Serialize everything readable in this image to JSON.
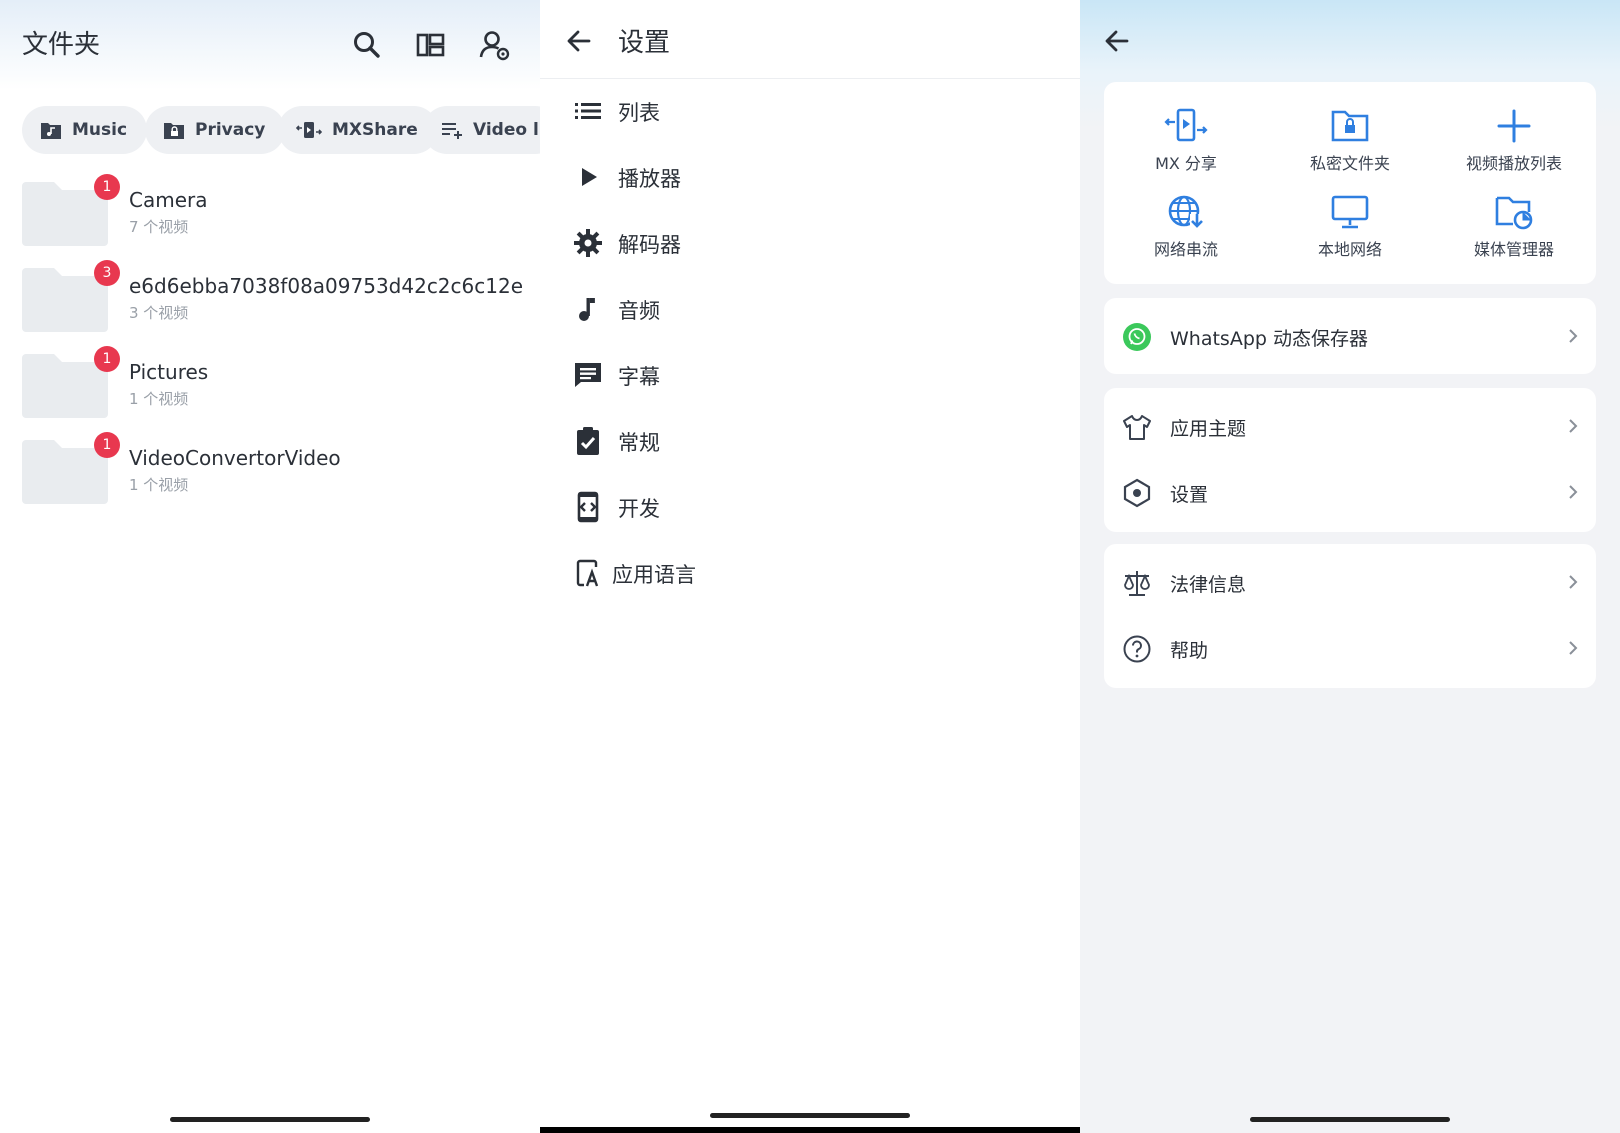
{
  "panel1": {
    "title": "文件夹",
    "icons": [
      "search-icon",
      "layout-icon",
      "account-settings-icon"
    ],
    "chips": [
      {
        "label": "Music",
        "icon": "music-folder-icon"
      },
      {
        "label": "Privacy",
        "icon": "lock-folder-icon"
      },
      {
        "label": "MXShare",
        "icon": "share-icon"
      },
      {
        "label": "Video l",
        "icon": "playlist-add-icon"
      }
    ],
    "folders": [
      {
        "name": "Camera",
        "count": "7 个视频",
        "badge": "1"
      },
      {
        "name": "e6d6ebba7038f08a09753d42c2c6c12e",
        "count": "3 个视频",
        "badge": "3"
      },
      {
        "name": "Pictures",
        "count": "1 个视频",
        "badge": "1"
      },
      {
        "name": "VideoConvertorVideo",
        "count": "1 个视频",
        "badge": "1"
      }
    ],
    "colors": {
      "badge": "#e8384f",
      "folder": "#e9ecef"
    }
  },
  "panel2": {
    "title": "设置",
    "items": [
      {
        "label": "列表",
        "icon": "list-icon"
      },
      {
        "label": "播放器",
        "icon": "play-icon"
      },
      {
        "label": "解码器",
        "icon": "gear-icon"
      },
      {
        "label": "音频",
        "icon": "music-note-icon"
      },
      {
        "label": "字幕",
        "icon": "subtitle-icon"
      },
      {
        "label": "常规",
        "icon": "clipboard-check-icon"
      },
      {
        "label": "开发",
        "icon": "developer-icon"
      },
      {
        "label": "应用语言",
        "icon": "language-icon"
      }
    ]
  },
  "panel3": {
    "grid": [
      {
        "label": "MX 分享",
        "icon": "mx-share-icon"
      },
      {
        "label": "私密文件夹",
        "icon": "private-folder-icon"
      },
      {
        "label": "视频播放列表",
        "icon": "plus-icon"
      },
      {
        "label": "网络串流",
        "icon": "network-stream-icon"
      },
      {
        "label": "本地网络",
        "icon": "monitor-icon"
      },
      {
        "label": "媒体管理器",
        "icon": "media-manager-icon"
      }
    ],
    "whatsapp": {
      "label": "WhatsApp 动态保存器",
      "icon": "whatsapp-icon"
    },
    "group1": [
      {
        "label": "应用主题",
        "icon": "shirt-icon"
      },
      {
        "label": "设置",
        "icon": "hexagon-settings-icon"
      }
    ],
    "group2": [
      {
        "label": "法律信息",
        "icon": "scale-icon"
      },
      {
        "label": "帮助",
        "icon": "help-icon"
      }
    ],
    "colors": {
      "accent": "#2f7fe0",
      "whatsapp": "#3bc85b"
    }
  }
}
